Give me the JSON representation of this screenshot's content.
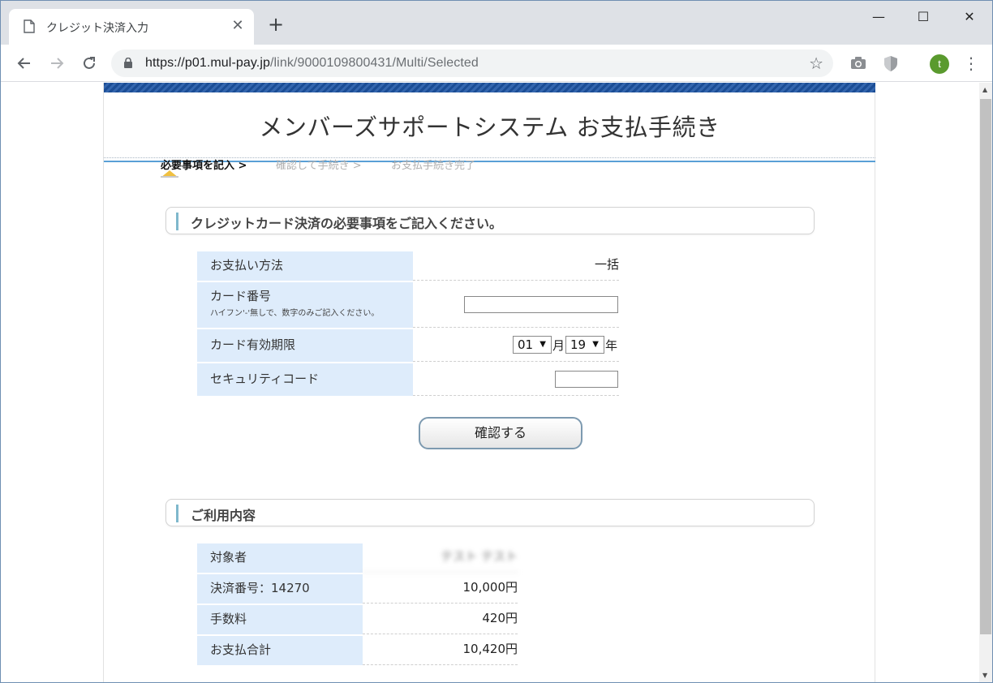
{
  "browser": {
    "tab_title": "クレジット決済入力",
    "tab_close": "✕",
    "new_tab": "+",
    "url_host": "https://p01.mul-pay.jp",
    "url_path": "/link/9000109800431/Multi/Selected",
    "avatar_letter": "t",
    "window_controls": {
      "minimize": "—",
      "maximize": "☐",
      "close": "✕"
    }
  },
  "page": {
    "site_title": "メンバーズサポートシステム お支払手続き",
    "steps": [
      {
        "label": "必要事項を記入 >",
        "state": "active"
      },
      {
        "label": "確認して手続き >",
        "state": "inactive"
      },
      {
        "label": "お支払手続き完了",
        "state": "inactive"
      }
    ],
    "form_section": {
      "title": "クレジットカード決済の必要事項をご記入ください。",
      "rows": [
        {
          "label": "お支払い方法",
          "value": "一括"
        },
        {
          "label": "カード番号",
          "note": "ハイフン'-'無しで、数字のみご記入ください。",
          "value": ""
        },
        {
          "label": "カード有効期限",
          "month": "01",
          "month_unit": "月",
          "year": "19",
          "year_unit": "年"
        },
        {
          "label": "セキュリティコード",
          "value": ""
        }
      ],
      "confirm_button": "確認する"
    },
    "usage_section": {
      "title": "ご利用内容",
      "rows": [
        {
          "label": "対象者",
          "value": "テスト テスト"
        },
        {
          "label": "決済番号：14270",
          "value": "10,000円"
        },
        {
          "label": "手数料",
          "value": "420円"
        },
        {
          "label": "お支払合計",
          "value": "10,420円"
        }
      ]
    }
  },
  "colors": {
    "stripe": "#1b4d95",
    "label_bg": "#deecfb",
    "accent_line": "#5aa0d6",
    "section_bar": "#7fb8cc",
    "avatar": "#5a9a2e"
  }
}
